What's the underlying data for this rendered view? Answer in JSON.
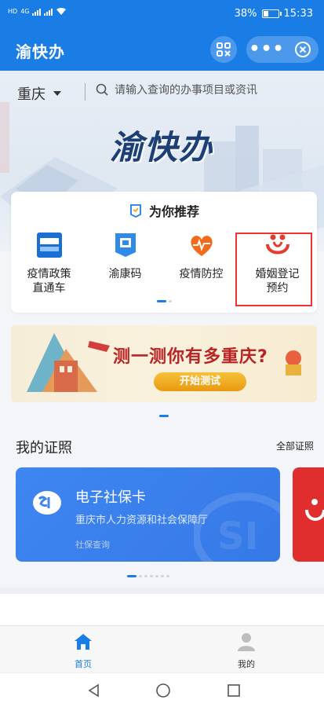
{
  "status_bar": {
    "carrier_left": "HD",
    "network": "4G",
    "battery": "38%",
    "time": "15:33"
  },
  "header": {
    "title": "渝快办",
    "scan_icon": "scan-icon",
    "more_icon": "more-dots-icon",
    "close_icon": "close-circle-icon",
    "more_label": "•••"
  },
  "location": {
    "city": "重庆"
  },
  "search": {
    "placeholder": "请输入查询的办事项目或资讯"
  },
  "hero": {
    "logo_text": "渝快办"
  },
  "recommend": {
    "title": "为你推荐",
    "items": [
      {
        "label_line1": "疫情政策",
        "label_line2": "直通车",
        "icon": "policy-express-icon",
        "icon_color": "#1a6fd4"
      },
      {
        "label_line1": "渝康码",
        "label_line2": "",
        "icon": "health-code-icon",
        "icon_color": "#2f8ae8"
      },
      {
        "label_line1": "疫情防控",
        "label_line2": "",
        "icon": "heart-pulse-icon",
        "icon_color": "#f26a1b"
      },
      {
        "label_line1": "婚姻登记",
        "label_line2": "预约",
        "icon": "marriage-icon",
        "icon_color": "#e63a2e"
      }
    ]
  },
  "banner": {
    "title": "测一测你有多重庆?",
    "button": "开始测试"
  },
  "licenses": {
    "title": "我的证照",
    "all_link": "全部证照",
    "social_card": {
      "name": "电子社保卡",
      "org": "重庆市人力资源和社会保障厅",
      "link": "社保查询"
    }
  },
  "bottom_nav": {
    "home": "首页",
    "mine": "我的"
  },
  "colors": {
    "brand_blue": "#1a7de6",
    "highlight_red": "#e33333",
    "social_card_blue": "#3f86f2",
    "banner_button": "#f0a521"
  }
}
